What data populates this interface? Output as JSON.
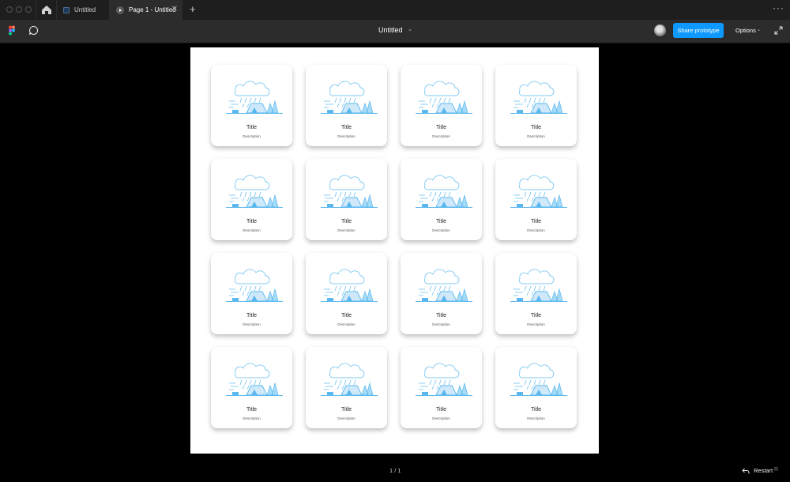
{
  "tabs": {
    "items": [
      {
        "label": "Untitled",
        "active": false
      },
      {
        "label": "Page 1 - Untitled",
        "active": true
      }
    ],
    "close_glyph": "✕",
    "add_glyph": "+",
    "more_glyph": "···"
  },
  "toolbar": {
    "file_title": "Untitled",
    "share_label": "Share prototype",
    "options_label": "Options",
    "chev": "⌄",
    "accent": "#0d99ff"
  },
  "cards": [
    {
      "title": "Title",
      "description": "Description"
    },
    {
      "title": "Title",
      "description": "Description"
    },
    {
      "title": "Title",
      "description": "Description"
    },
    {
      "title": "Title",
      "description": "Description"
    },
    {
      "title": "Title",
      "description": "Description"
    },
    {
      "title": "Title",
      "description": "Description"
    },
    {
      "title": "Title",
      "description": "Description"
    },
    {
      "title": "Title",
      "description": "Description"
    },
    {
      "title": "Title",
      "description": "Description"
    },
    {
      "title": "Title",
      "description": "Description"
    },
    {
      "title": "Title",
      "description": "Description"
    },
    {
      "title": "Title",
      "description": "Description"
    },
    {
      "title": "Title",
      "description": "Description"
    },
    {
      "title": "Title",
      "description": "Description"
    },
    {
      "title": "Title",
      "description": "Description"
    },
    {
      "title": "Title",
      "description": "Description"
    }
  ],
  "footer": {
    "page_counter": "1 / 1",
    "restart_label": "Restart",
    "restart_key": "R"
  },
  "icons": [
    "home-icon",
    "file-icon",
    "play-icon",
    "figma-logo-icon",
    "comment-icon",
    "expand-icon",
    "restart-icon",
    "camping-rain-illustration"
  ]
}
